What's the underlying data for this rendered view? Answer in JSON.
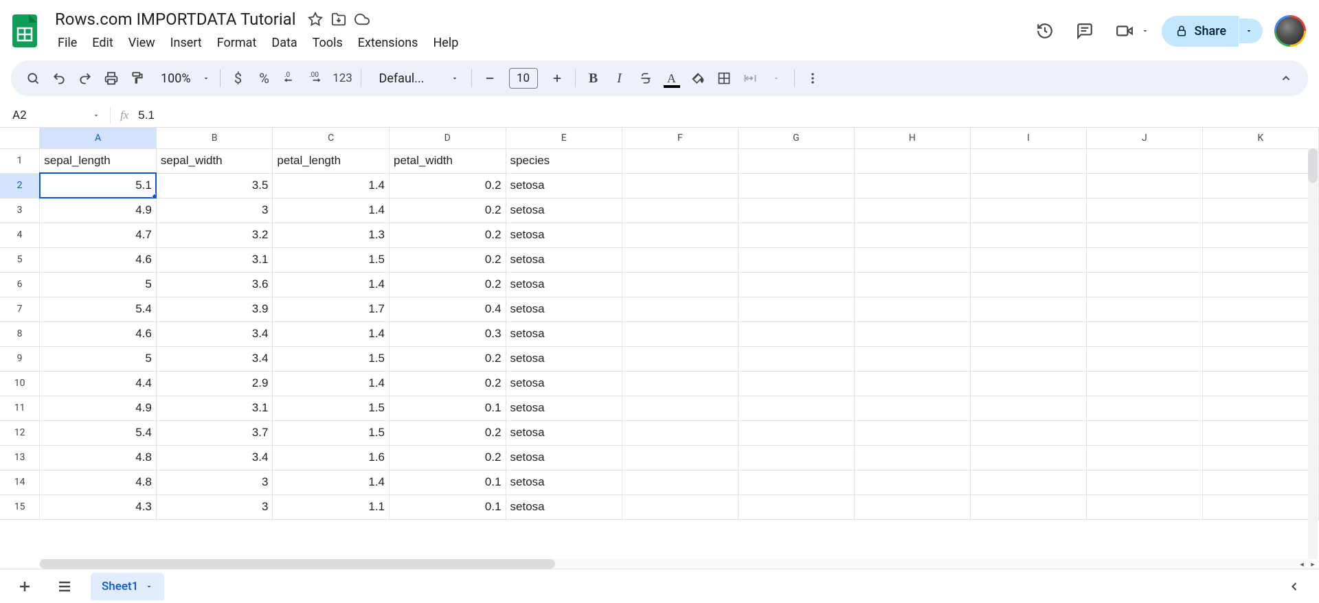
{
  "doc": {
    "title": "Rows.com IMPORTDATA Tutorial"
  },
  "menus": [
    "File",
    "Edit",
    "View",
    "Insert",
    "Format",
    "Data",
    "Tools",
    "Extensions",
    "Help"
  ],
  "share": {
    "label": "Share"
  },
  "toolbar": {
    "zoom": "100%",
    "font": "Defaul...",
    "fontSize": "10",
    "numFmt123": "123"
  },
  "nameBox": "A2",
  "formula": "5.1",
  "columns": [
    "A",
    "B",
    "C",
    "D",
    "E",
    "F",
    "G",
    "H",
    "I",
    "J",
    "K"
  ],
  "activeCol": "A",
  "activeRowIdx": 1,
  "rows": [
    {
      "n": "1",
      "cells": [
        "sepal_length",
        "sepal_width",
        "petal_length",
        "petal_width",
        "species",
        "",
        "",
        "",
        "",
        "",
        ""
      ],
      "types": [
        "txt",
        "txt",
        "txt",
        "txt",
        "txt",
        "txt",
        "txt",
        "txt",
        "txt",
        "txt",
        "txt"
      ]
    },
    {
      "n": "2",
      "cells": [
        "5.1",
        "3.5",
        "1.4",
        "0.2",
        "setosa",
        "",
        "",
        "",
        "",
        "",
        ""
      ],
      "types": [
        "num",
        "num",
        "num",
        "num",
        "txt",
        "txt",
        "txt",
        "txt",
        "txt",
        "txt",
        "txt"
      ]
    },
    {
      "n": "3",
      "cells": [
        "4.9",
        "3",
        "1.4",
        "0.2",
        "setosa",
        "",
        "",
        "",
        "",
        "",
        ""
      ],
      "types": [
        "num",
        "num",
        "num",
        "num",
        "txt",
        "txt",
        "txt",
        "txt",
        "txt",
        "txt",
        "txt"
      ]
    },
    {
      "n": "4",
      "cells": [
        "4.7",
        "3.2",
        "1.3",
        "0.2",
        "setosa",
        "",
        "",
        "",
        "",
        "",
        ""
      ],
      "types": [
        "num",
        "num",
        "num",
        "num",
        "txt",
        "txt",
        "txt",
        "txt",
        "txt",
        "txt",
        "txt"
      ]
    },
    {
      "n": "5",
      "cells": [
        "4.6",
        "3.1",
        "1.5",
        "0.2",
        "setosa",
        "",
        "",
        "",
        "",
        "",
        ""
      ],
      "types": [
        "num",
        "num",
        "num",
        "num",
        "txt",
        "txt",
        "txt",
        "txt",
        "txt",
        "txt",
        "txt"
      ]
    },
    {
      "n": "6",
      "cells": [
        "5",
        "3.6",
        "1.4",
        "0.2",
        "setosa",
        "",
        "",
        "",
        "",
        "",
        ""
      ],
      "types": [
        "num",
        "num",
        "num",
        "num",
        "txt",
        "txt",
        "txt",
        "txt",
        "txt",
        "txt",
        "txt"
      ]
    },
    {
      "n": "7",
      "cells": [
        "5.4",
        "3.9",
        "1.7",
        "0.4",
        "setosa",
        "",
        "",
        "",
        "",
        "",
        ""
      ],
      "types": [
        "num",
        "num",
        "num",
        "num",
        "txt",
        "txt",
        "txt",
        "txt",
        "txt",
        "txt",
        "txt"
      ]
    },
    {
      "n": "8",
      "cells": [
        "4.6",
        "3.4",
        "1.4",
        "0.3",
        "setosa",
        "",
        "",
        "",
        "",
        "",
        ""
      ],
      "types": [
        "num",
        "num",
        "num",
        "num",
        "txt",
        "txt",
        "txt",
        "txt",
        "txt",
        "txt",
        "txt"
      ]
    },
    {
      "n": "9",
      "cells": [
        "5",
        "3.4",
        "1.5",
        "0.2",
        "setosa",
        "",
        "",
        "",
        "",
        "",
        ""
      ],
      "types": [
        "num",
        "num",
        "num",
        "num",
        "txt",
        "txt",
        "txt",
        "txt",
        "txt",
        "txt",
        "txt"
      ]
    },
    {
      "n": "10",
      "cells": [
        "4.4",
        "2.9",
        "1.4",
        "0.2",
        "setosa",
        "",
        "",
        "",
        "",
        "",
        ""
      ],
      "types": [
        "num",
        "num",
        "num",
        "num",
        "txt",
        "txt",
        "txt",
        "txt",
        "txt",
        "txt",
        "txt"
      ]
    },
    {
      "n": "11",
      "cells": [
        "4.9",
        "3.1",
        "1.5",
        "0.1",
        "setosa",
        "",
        "",
        "",
        "",
        "",
        ""
      ],
      "types": [
        "num",
        "num",
        "num",
        "num",
        "txt",
        "txt",
        "txt",
        "txt",
        "txt",
        "txt",
        "txt"
      ]
    },
    {
      "n": "12",
      "cells": [
        "5.4",
        "3.7",
        "1.5",
        "0.2",
        "setosa",
        "",
        "",
        "",
        "",
        "",
        ""
      ],
      "types": [
        "num",
        "num",
        "num",
        "num",
        "txt",
        "txt",
        "txt",
        "txt",
        "txt",
        "txt",
        "txt"
      ]
    },
    {
      "n": "13",
      "cells": [
        "4.8",
        "3.4",
        "1.6",
        "0.2",
        "setosa",
        "",
        "",
        "",
        "",
        "",
        ""
      ],
      "types": [
        "num",
        "num",
        "num",
        "num",
        "txt",
        "txt",
        "txt",
        "txt",
        "txt",
        "txt",
        "txt"
      ]
    },
    {
      "n": "14",
      "cells": [
        "4.8",
        "3",
        "1.4",
        "0.1",
        "setosa",
        "",
        "",
        "",
        "",
        "",
        ""
      ],
      "types": [
        "num",
        "num",
        "num",
        "num",
        "txt",
        "txt",
        "txt",
        "txt",
        "txt",
        "txt",
        "txt"
      ]
    },
    {
      "n": "15",
      "cells": [
        "4.3",
        "3",
        "1.1",
        "0.1",
        "setosa",
        "",
        "",
        "",
        "",
        "",
        ""
      ],
      "types": [
        "num",
        "num",
        "num",
        "num",
        "txt",
        "txt",
        "txt",
        "txt",
        "txt",
        "txt",
        "txt"
      ]
    }
  ],
  "sheetTab": "Sheet1"
}
